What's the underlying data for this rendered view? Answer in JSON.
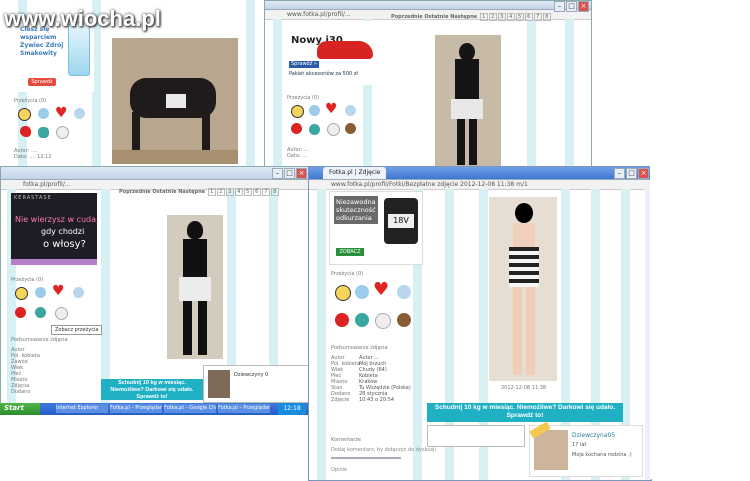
{
  "watermark": "www.wiocha.pl",
  "top_left_window": {
    "ad_text": "Ciesz się wsparciem Żywiec Zdrój Smakowity",
    "ad_button": "Sprawdź"
  },
  "top_right_window": {
    "url": "www.fotka.pl/profil/...",
    "pager_label": "Poprzednie Ostatnie Następne",
    "pager_numbers": [
      "1",
      "2",
      "3",
      "4",
      "5",
      "6",
      "7",
      "8",
      "9",
      "10"
    ],
    "car_ad_title": "Nowy i30",
    "car_ad_text": "Już od 2,99% RRSO",
    "car_ad_offer": "Pakiet akcesoriów za 500 zł",
    "car_ad_cta": "Sprawdź »",
    "reactions_label": "Przeżycia (0)",
    "info_lines": [
      "Autor: ...",
      "Data: ..."
    ]
  },
  "mid_left_window": {
    "url": "fotka.pl/profil/...",
    "ad_line1": "Nie wierzysz w cuda,",
    "ad_line2": "gdy chodzi",
    "ad_line3": "o włosy?",
    "ad_brand": "KERASTASE",
    "pager_label": "Poprzednie Ostatnie Następne",
    "pager_numbers": [
      "1",
      "2",
      "3",
      "4",
      "5",
      "6",
      "7",
      "8",
      "9",
      "10"
    ],
    "reactions_label": "Przeżycia (0)",
    "tooltip": "Zobacz przeżycia",
    "details_label": "Podsumowanie zdjęcia",
    "details_values": [
      "Autor",
      "Pol. kobieta",
      "Zawód",
      "Wiek",
      "Płeć",
      "Miasto",
      "Zdjęcia",
      "Dodano"
    ],
    "user_caption": "Dziewczyny 0",
    "banner": "Schudnij 10 kg w miesiąc. Niemożliwe? Darkowi się udało. Sprawdź to!",
    "taskbar_start": "Start",
    "taskbar_items": [
      "Internet Explorer",
      "Fotka.pl – Przeglądarka",
      "Fotka.pl – Google Chrome",
      "Fotka.pl – Przeglądarka"
    ],
    "clock": "12:18"
  },
  "main_window": {
    "tab_label": "Fotka.pl | Zdjęcie",
    "url": "www.fotka.pl/profil/Fotki/Bezpłatne zdjęcie 2012-12-08 11:38 m/1",
    "ad_title": "Niezawodna skuteczność odkurzania",
    "ad_battery": "18V",
    "ad_button": "ZOBACZ",
    "reactions_label": "Przeżycia (0)",
    "details_label": "Podsumowanie zdjęcia",
    "details_keys": [
      "Autor",
      "Pol. kobieta",
      "Wiek",
      "Płeć",
      "Miasto",
      "Stan",
      "Dodano",
      "Zdjęcie"
    ],
    "details_values": [
      "Autor ...",
      "Mój brzuch",
      "Chudy (64)",
      "Kobieta",
      "Kraków",
      "Tu Wszędzie (Polska)",
      "28 stycznia",
      "10:43 o 20:54"
    ],
    "photo_caption": "2012-12-08 11:38",
    "banner": "Schudnij 10 kg w miesiąc. Niemożliwe? Darkowi się udało. Sprawdź to!",
    "comments_label": "Komentarze",
    "comment_hint": "Dodaj komentarz, by dołączyć do dyskusji",
    "sidebar_user_name": "Dziewczyna05",
    "sidebar_user_meta": "17 lat",
    "sidebar_user_desc": "Moja kochana rodzina :)",
    "colors": {
      "banner": "#1fb0c4",
      "stripe": "#d6f0f4",
      "titlebar": "#c3d3e8",
      "taskbar": "#245ec8"
    }
  }
}
